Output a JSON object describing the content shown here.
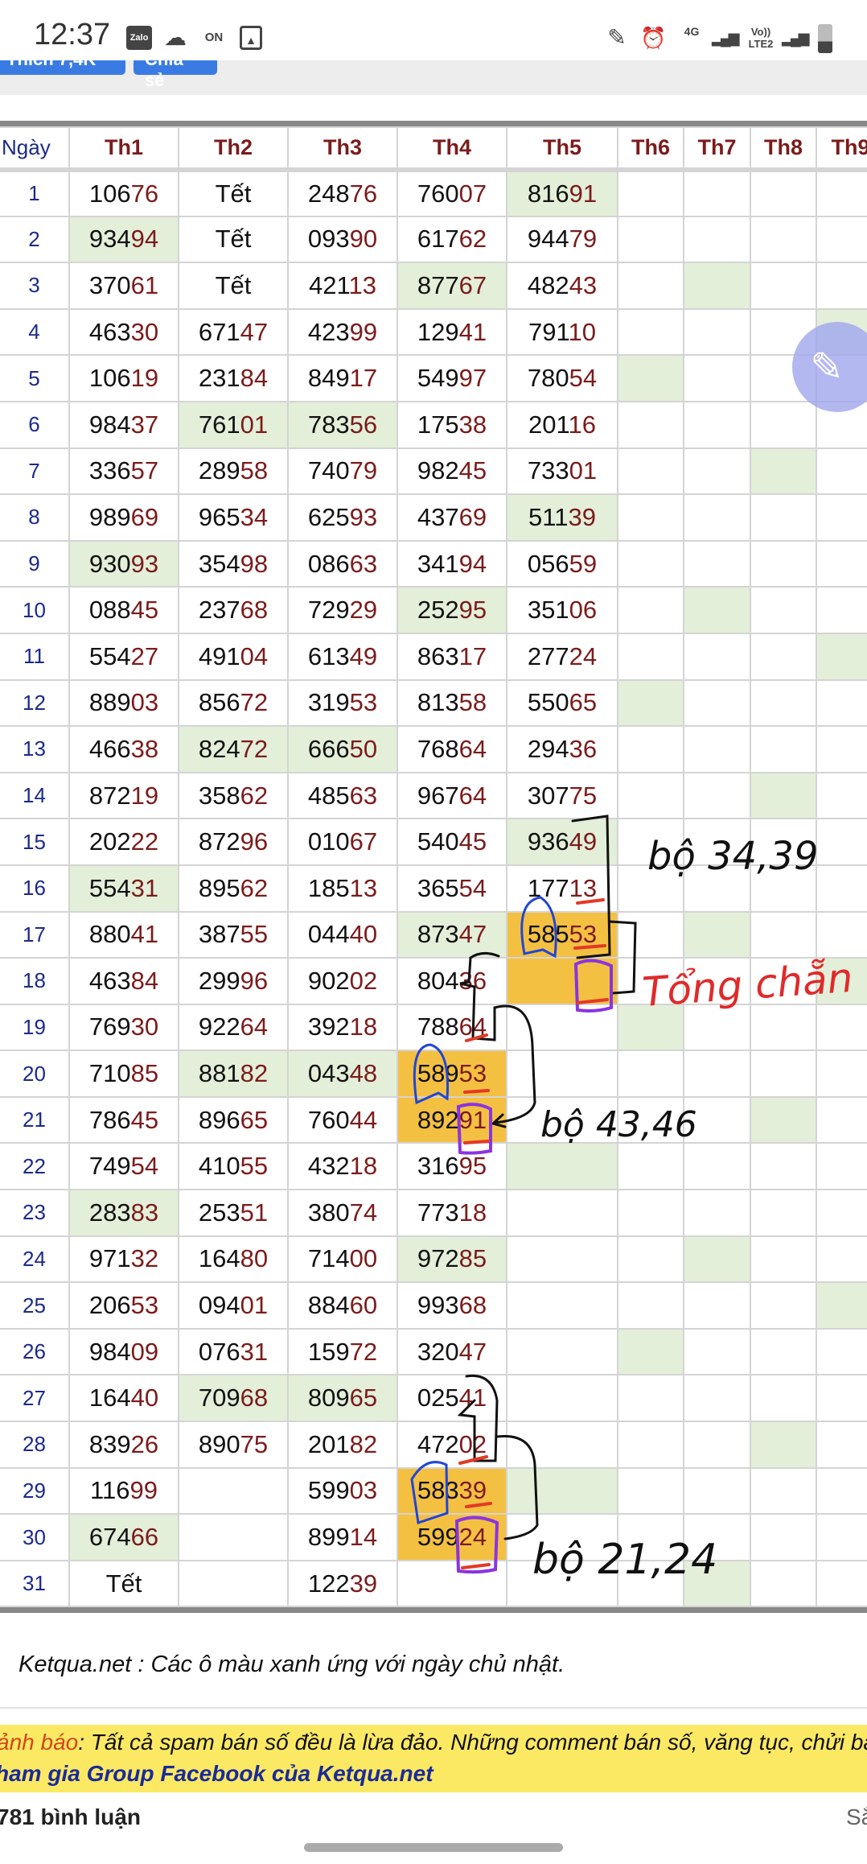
{
  "status_bar": {
    "time": "12:37",
    "icons": [
      "zalo-icon",
      "cloud-icon",
      "on-icon",
      "image-icon",
      "pen-icon",
      "alarm-icon",
      "4g-icon",
      "signal-icon",
      "volte-lte2-icon",
      "signal-icon",
      "battery-icon"
    ],
    "zalo": "Zalo",
    "on": "ON",
    "net": "4G",
    "lte": "Vo)) LTE2"
  },
  "social": {
    "like_label": "Thích 7,4K",
    "share_label": "Chia sẻ"
  },
  "table": {
    "headers": [
      "Ngày",
      "Th1",
      "Th2",
      "Th3",
      "Th4",
      "Th5",
      "Th6",
      "Th7",
      "Th8",
      "Th9"
    ],
    "rows": [
      [
        "1",
        "10676",
        "Tết",
        "24876",
        "76007",
        "81691",
        "",
        "",
        "",
        ""
      ],
      [
        "2",
        "93494",
        "Tết",
        "09390",
        "61762",
        "94479",
        "",
        "",
        "",
        ""
      ],
      [
        "3",
        "37061",
        "Tết",
        "42113",
        "87767",
        "48243",
        "",
        "",
        "",
        ""
      ],
      [
        "4",
        "46330",
        "67147",
        "42399",
        "12941",
        "79110",
        "",
        "",
        "",
        ""
      ],
      [
        "5",
        "10619",
        "23184",
        "84917",
        "54997",
        "78054",
        "",
        "",
        "",
        ""
      ],
      [
        "6",
        "98437",
        "76101",
        "78356",
        "17538",
        "20116",
        "",
        "",
        "",
        ""
      ],
      [
        "7",
        "33657",
        "28958",
        "74079",
        "98245",
        "73301",
        "",
        "",
        "",
        ""
      ],
      [
        "8",
        "98969",
        "96534",
        "62593",
        "43769",
        "51139",
        "",
        "",
        "",
        ""
      ],
      [
        "9",
        "93093",
        "35498",
        "08663",
        "34194",
        "05659",
        "",
        "",
        "",
        ""
      ],
      [
        "10",
        "08845",
        "23768",
        "72929",
        "25295",
        "35106",
        "",
        "",
        "",
        ""
      ],
      [
        "11",
        "55427",
        "49104",
        "61349",
        "86317",
        "27724",
        "",
        "",
        "",
        ""
      ],
      [
        "12",
        "88903",
        "85672",
        "31953",
        "81358",
        "55065",
        "",
        "",
        "",
        ""
      ],
      [
        "13",
        "46638",
        "82472",
        "66650",
        "76864",
        "29436",
        "",
        "",
        "",
        ""
      ],
      [
        "14",
        "87219",
        "35862",
        "48563",
        "96764",
        "30775",
        "",
        "",
        "",
        ""
      ],
      [
        "15",
        "20222",
        "87296",
        "01067",
        "54045",
        "93649",
        "",
        "",
        "",
        ""
      ],
      [
        "16",
        "55431",
        "89562",
        "18513",
        "36554",
        "17713",
        "",
        "",
        "",
        ""
      ],
      [
        "17",
        "88041",
        "38755",
        "04440",
        "87347",
        "58553",
        "",
        "",
        "",
        ""
      ],
      [
        "18",
        "46384",
        "29996",
        "90202",
        "80436",
        "",
        "",
        "",
        "",
        ""
      ],
      [
        "19",
        "76930",
        "92264",
        "39218",
        "78864",
        "",
        "",
        "",
        "",
        ""
      ],
      [
        "20",
        "71085",
        "88182",
        "04348",
        "58953",
        "",
        "",
        "",
        "",
        ""
      ],
      [
        "21",
        "78645",
        "89665",
        "76044",
        "89291",
        "",
        "",
        "",
        "",
        ""
      ],
      [
        "22",
        "74954",
        "41055",
        "43218",
        "31695",
        "",
        "",
        "",
        "",
        ""
      ],
      [
        "23",
        "28383",
        "25351",
        "38074",
        "77318",
        "",
        "",
        "",
        "",
        ""
      ],
      [
        "24",
        "97132",
        "16480",
        "71400",
        "97285",
        "",
        "",
        "",
        "",
        ""
      ],
      [
        "25",
        "20653",
        "09401",
        "88460",
        "99368",
        "",
        "",
        "",
        "",
        ""
      ],
      [
        "26",
        "98409",
        "07631",
        "15972",
        "32047",
        "",
        "",
        "",
        "",
        ""
      ],
      [
        "27",
        "16440",
        "70968",
        "80965",
        "02541",
        "",
        "",
        "",
        "",
        ""
      ],
      [
        "28",
        "83926",
        "89075",
        "20182",
        "47202",
        "",
        "",
        "",
        "",
        ""
      ],
      [
        "29",
        "11699",
        "",
        "59903",
        "58339",
        "",
        "",
        "",
        "",
        ""
      ],
      [
        "30",
        "67466",
        "",
        "89914",
        "59924",
        "",
        "",
        "",
        "",
        ""
      ],
      [
        "31",
        "Tết",
        "",
        "12239",
        "",
        "",
        "",
        "",
        "",
        ""
      ]
    ],
    "sunday_cells": {
      "1": [
        2,
        9,
        16,
        23,
        30
      ],
      "2": [
        6,
        13,
        20,
        27
      ],
      "3": [
        6,
        13,
        20,
        27
      ],
      "4": [
        3,
        10,
        17,
        24
      ],
      "5": [
        1,
        8,
        15,
        22,
        29
      ],
      "6": [
        5,
        12,
        19,
        26
      ],
      "7": [
        3,
        10,
        17,
        24,
        31
      ],
      "8": [
        7,
        14,
        21,
        28
      ],
      "9": [
        4,
        11,
        18,
        25
      ]
    },
    "highlighted_cells": {
      "5": [
        17,
        18
      ],
      "4": [
        20,
        21,
        29,
        30
      ]
    },
    "colors": {
      "sunday": "#e3efd9",
      "highlight": "#f4c042",
      "tail_digits": "#7b1c1c",
      "day_number": "#1b2a8a"
    }
  },
  "annotations": {
    "a1": "bộ 34,39",
    "a2": "Tổng chẵn",
    "a3": "bộ 43,46",
    "a4": "bộ 21,24"
  },
  "fab_icon": "edit-pen-icon",
  "note": "Ketqua.net : Các ô màu xanh ứng với ngày chủ nhật.",
  "warning": {
    "label": "ảnh báo",
    "text": ": Tất cả spam bán số đều là lừa đảo. Những comment bán số, văng tục, chửi bậ",
    "link": "ham gia Group Facebook của Ketqua.net"
  },
  "comments": {
    "count_label": "781 bình luận",
    "sort_label": "Sắ"
  }
}
